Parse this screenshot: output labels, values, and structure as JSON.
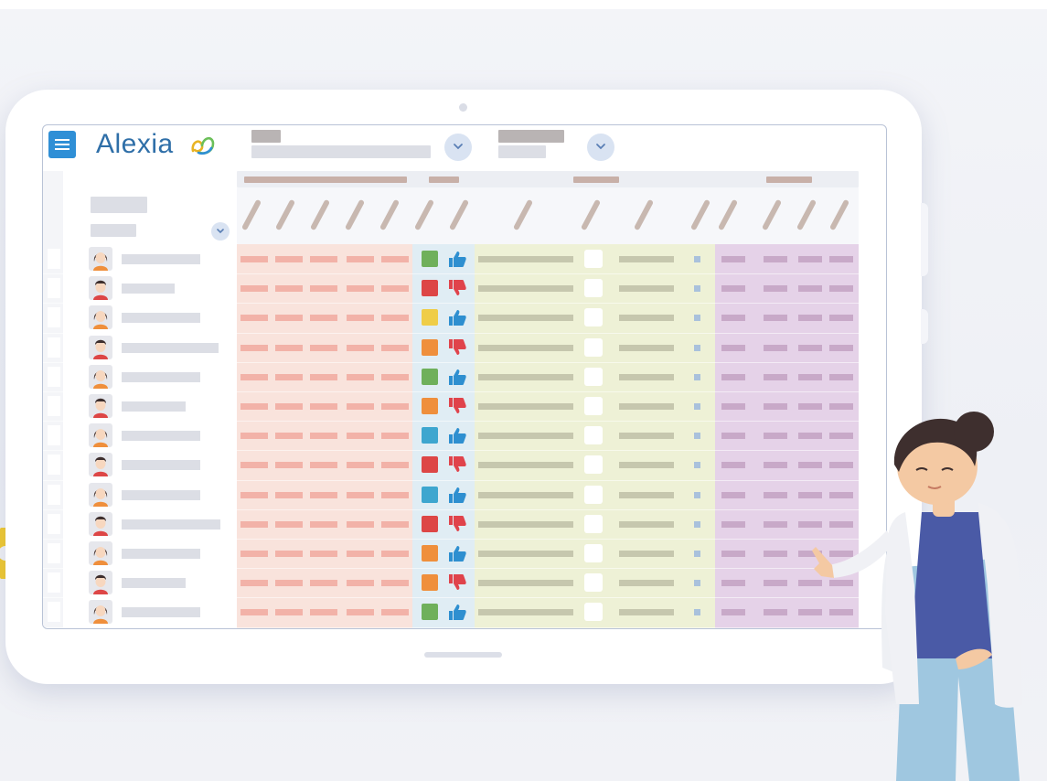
{
  "app": {
    "logo_text": "Alexia"
  },
  "icons": {
    "menu": "hamburger-menu-icon",
    "logo": "alexia-logo-mark-icon",
    "dropdown": "chevron-down-icon",
    "approve": "thumbs-up-icon",
    "disapprove": "thumbs-down-icon",
    "avatar_female": "student-avatar-female-icon",
    "avatar_male": "student-avatar-male-icon",
    "decoration": "gear-icon"
  },
  "colors": {
    "brand_blue": "#2f8fd6",
    "logo_text": "#2f6fa8",
    "section_red": "#f9e3dc",
    "section_blue": "#e0edf4",
    "section_green": "#eef1d6",
    "section_purple": "#e5d2e8",
    "status_green": "#6fb05b",
    "status_red": "#dd4646",
    "status_yellow": "#efcd47",
    "status_orange": "#ef8f3c",
    "status_blue": "#3ea6cf",
    "thumb_up": "#2e8fd0",
    "thumb_down": "#e0434b"
  },
  "students": [
    {
      "avatar": "female",
      "status": "green",
      "rating": "up"
    },
    {
      "avatar": "male",
      "status": "red",
      "rating": "down"
    },
    {
      "avatar": "female",
      "status": "yellow",
      "rating": "up"
    },
    {
      "avatar": "male",
      "status": "orange",
      "rating": "down"
    },
    {
      "avatar": "female",
      "status": "green",
      "rating": "up"
    },
    {
      "avatar": "male",
      "status": "orange",
      "rating": "down"
    },
    {
      "avatar": "female",
      "status": "blue",
      "rating": "up"
    },
    {
      "avatar": "male",
      "status": "red",
      "rating": "down"
    },
    {
      "avatar": "female",
      "status": "blue",
      "rating": "up"
    },
    {
      "avatar": "male",
      "status": "red",
      "rating": "down"
    },
    {
      "avatar": "female",
      "status": "orange",
      "rating": "up"
    },
    {
      "avatar": "male",
      "status": "orange",
      "rating": "down"
    },
    {
      "avatar": "female",
      "status": "green",
      "rating": "up"
    }
  ]
}
